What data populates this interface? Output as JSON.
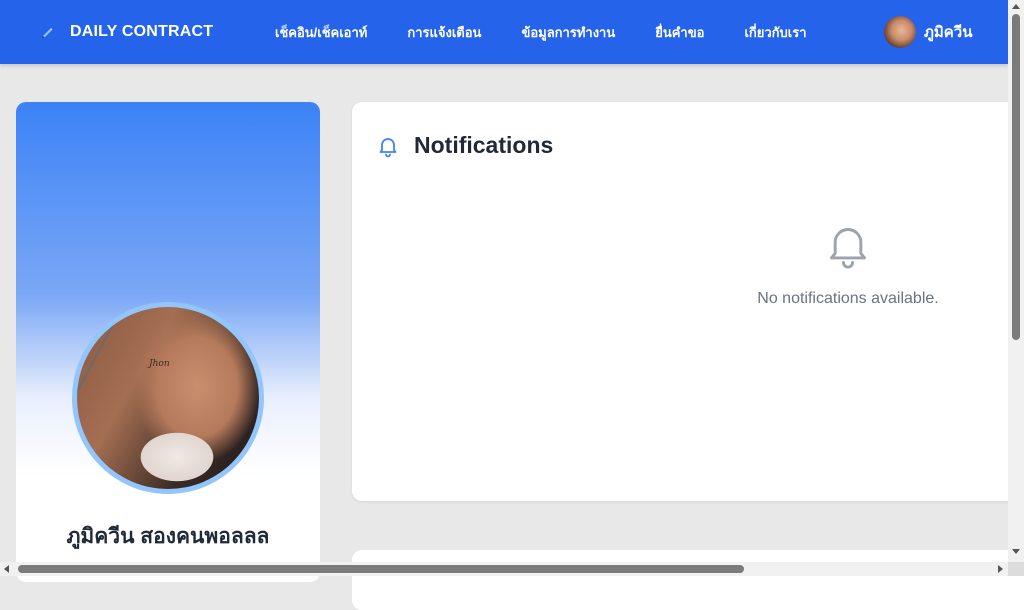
{
  "navbar": {
    "brand": "DAILY CONTRACT",
    "brand_icon": "pencil-icon",
    "links": [
      "เช็คอิน/เช็คเอาท์",
      "การแจ้งเตือน",
      "ข้อมูลการทำงาน",
      "ยื่นคำขอ",
      "เกี่ยวกับเรา"
    ],
    "username": "ภูมิควีน",
    "accent_color": "#2563eb"
  },
  "profile": {
    "name": "ภูมิควีน สองคนพอลลล",
    "photo_tattoo": "Jhon"
  },
  "notifications": {
    "title": "Notifications",
    "title_icon": "bell-icon",
    "empty_icon": "bell-icon",
    "empty_message": "No notifications available."
  }
}
